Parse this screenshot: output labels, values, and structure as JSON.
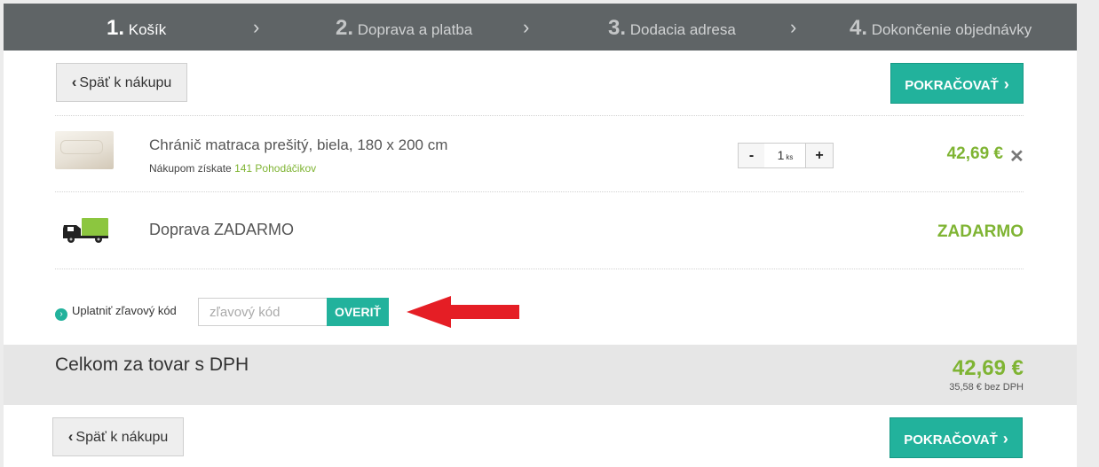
{
  "steps": [
    {
      "num": "1.",
      "label": "Košík"
    },
    {
      "num": "2.",
      "label": "Doprava a platba"
    },
    {
      "num": "3.",
      "label": "Dodacia adresa"
    },
    {
      "num": "4.",
      "label": "Dokončenie objednávky"
    }
  ],
  "nav": {
    "back_label": "Späť k nákupu",
    "continue_label": "POKRAČOVAŤ"
  },
  "cart": {
    "product": {
      "name": "Chránič matraca prešitý, biela, 180 x 200 cm",
      "points_prefix": "Nákupom získate",
      "points_value": "141 Pohodáčikov",
      "quantity": "1",
      "unit": "ks",
      "minus": "-",
      "plus": "+",
      "price": "42,69 €",
      "remove": "✕"
    },
    "shipping": {
      "name": "Doprava ZADARMO",
      "price": "ZADARMO"
    }
  },
  "discount": {
    "label": "Uplatniť zľavový kód",
    "placeholder": "zľavový kód",
    "button": "OVERIŤ"
  },
  "total": {
    "label": "Celkom za tovar s DPH",
    "price": "42,69 €",
    "without_vat": "35,58 € bez DPH"
  },
  "colors": {
    "accent": "#22b29c",
    "price_green": "#7fb433",
    "steps_bg": "#5f6466",
    "arrow_red": "#e51e25"
  }
}
